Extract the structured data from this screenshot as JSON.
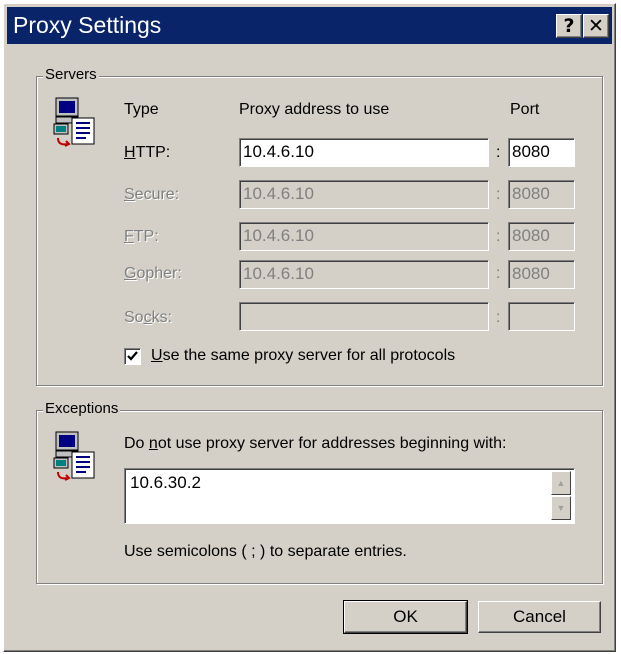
{
  "window": {
    "title": "Proxy Settings"
  },
  "titlebar": {
    "help_button": "?",
    "close_button": "✕"
  },
  "servers": {
    "group_label": "Servers",
    "col_type": "Type",
    "col_address": "Proxy address to use",
    "col_port": "Port",
    "rows": [
      {
        "label_ul": "H",
        "label_rest": "TTP:",
        "address": "10.4.6.10",
        "port": "8080"
      },
      {
        "label_ul": "S",
        "label_rest": "ecure:",
        "address": "10.4.6.10",
        "port": "8080"
      },
      {
        "label_ul": "F",
        "label_rest": "TP:",
        "address": "10.4.6.10",
        "port": "8080"
      },
      {
        "label_ul": "G",
        "label_rest": "opher:",
        "address": "10.4.6.10",
        "port": "8080"
      },
      {
        "label_pre": "So",
        "label_ul": "c",
        "label_rest": "ks:",
        "address": "",
        "port": ""
      }
    ],
    "colon": ":",
    "same_proxy_checked": true,
    "same_proxy_ul": "U",
    "same_proxy_rest": "se the same proxy server for all protocols"
  },
  "exceptions": {
    "group_label": "Exceptions",
    "desc_pre": "Do ",
    "desc_ul": "n",
    "desc_rest": "ot use proxy server for addresses beginning with:",
    "value": "10.6.30.2",
    "hint": "Use semicolons ( ; ) to separate entries."
  },
  "buttons": {
    "ok": "OK",
    "cancel": "Cancel"
  },
  "colors": {
    "titlebar": "#0a246a",
    "face": "#d4d0c8",
    "disabled_text": "#808080"
  },
  "icons": [
    "network-computer-icon",
    "network-computer-icon"
  ]
}
